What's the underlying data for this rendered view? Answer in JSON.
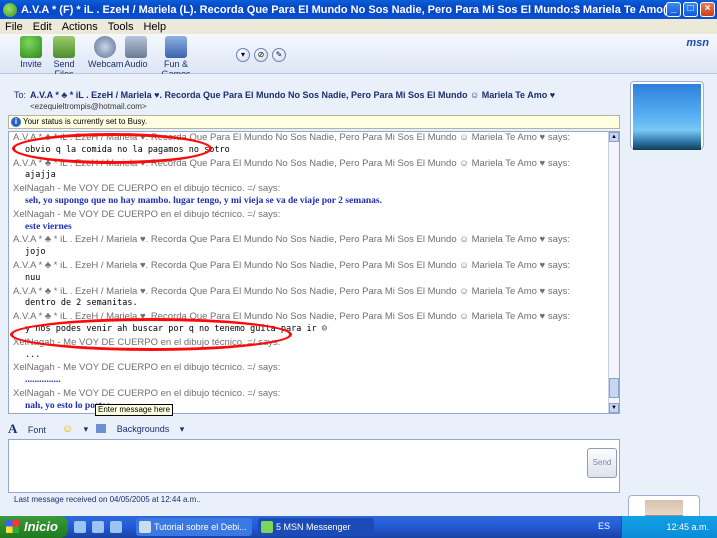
{
  "window": {
    "title": "A.V.A * (F) * iL . EzeH / Mariela (L). Recorda Que Para El Mundo No Sos Nadie, Pero Para Mi Sos El Mundo:$ Mariela Te Amo(L) - Conversation",
    "buttons": [
      "_",
      "□",
      "×"
    ]
  },
  "menu": [
    "File",
    "Edit",
    "Actions",
    "Tools",
    "Help"
  ],
  "toolbar": {
    "items": [
      {
        "label": "Invite",
        "icon": "invite-icon"
      },
      {
        "label": "Send Files",
        "icon": "send-files-icon"
      },
      {
        "label": "Webcam",
        "icon": "webcam-icon"
      },
      {
        "label": "Audio",
        "icon": "audio-icon"
      },
      {
        "label": "Fun & Games",
        "icon": "fun-games-icon"
      }
    ],
    "logo": "msn"
  },
  "to": {
    "label": "To:",
    "name": "A.V.A * ♣ * iL . EzeH / Mariela ♥. Recorda Que Para El Mundo No Sos Nadie, Pero Para Mi Sos El Mundo ☺ Mariela Te Amo ♥",
    "email": "<ezequieltrompis@hotmail.com>"
  },
  "status_notice": "Your status is currently set to Busy.",
  "conversation": [
    {
      "type": "says",
      "text": "A.V.A * ♣ * iL . EzeH / Mariela ♥. Recorda Que Para El Mundo No Sos Nadie, Pero Para Mi Sos El Mundo ☺ Mariela Te Amo ♥ says:"
    },
    {
      "type": "msg",
      "text": "obvio q la comida no la pagamos no sotro"
    },
    {
      "type": "says",
      "text": "A.V.A * ♣ * iL . EzeH / Mariela ♥. Recorda Que Para El Mundo No Sos Nadie, Pero Para Mi Sos El Mundo ☺ Mariela Te Amo ♥ says:"
    },
    {
      "type": "msg",
      "text": "ajajja"
    },
    {
      "type": "says",
      "text": "XelNagah - Me VOY DE CUERPO en el dibujo técnico. =/ says:"
    },
    {
      "type": "blue",
      "text": "seh, yo supongo que no hay mambo. lugar tengo, y mi vieja se va de viaje por 2 semanas."
    },
    {
      "type": "says",
      "text": "XelNagah - Me VOY DE CUERPO en el dibujo técnico. =/ says:"
    },
    {
      "type": "blue",
      "text": "este viernes"
    },
    {
      "type": "says",
      "text": "A.V.A * ♣ * iL . EzeH / Mariela ♥. Recorda Que Para El Mundo No Sos Nadie, Pero Para Mi Sos El Mundo ☺ Mariela Te Amo ♥ says:"
    },
    {
      "type": "msg",
      "text": "jojo"
    },
    {
      "type": "says",
      "text": "A.V.A * ♣ * iL . EzeH / Mariela ♥. Recorda Que Para El Mundo No Sos Nadie, Pero Para Mi Sos El Mundo ☺ Mariela Te Amo ♥ says:"
    },
    {
      "type": "msg",
      "text": "nuu"
    },
    {
      "type": "says",
      "text": "A.V.A * ♣ * iL . EzeH / Mariela ♥. Recorda Que Para El Mundo No Sos Nadie, Pero Para Mi Sos El Mundo ☺ Mariela Te Amo ♥ says:"
    },
    {
      "type": "msg",
      "text": "dentro de 2 semanitas."
    },
    {
      "type": "says",
      "text": "A.V.A * ♣ * iL . EzeH / Mariela ♥. Recorda Que Para El Mundo No Sos Nadie, Pero Para Mi Sos El Mundo ☺ Mariela Te Amo ♥ says:"
    },
    {
      "type": "msg",
      "text": "y nos podes venir ah buscar por q no tenemo guita para ir ☺"
    },
    {
      "type": "says",
      "text": "XelNagah - Me VOY DE CUERPO en el dibujo técnico. =/ says:"
    },
    {
      "type": "msg",
      "text": "..."
    },
    {
      "type": "says",
      "text": "XelNagah - Me VOY DE CUERPO en el dibujo técnico. =/ says:"
    },
    {
      "type": "blue",
      "text": "..............."
    },
    {
      "type": "says",
      "text": "XelNagah - Me VOY DE CUERPO en el dibujo técnico. =/ says:"
    },
    {
      "type": "blue",
      "text": "nah, yo esto lo posteo"
    }
  ],
  "format_bar": {
    "font": "Font",
    "emoticon": "☺",
    "backgrounds": "Backgrounds"
  },
  "input": {
    "tooltip": "Enter message here",
    "send": "Send"
  },
  "last_message": "Last message received on 04/05/2005 at 12:44 a.m..",
  "taskbar": {
    "start": "Inicio",
    "tasks": [
      "Tutorial sobre el Debi...",
      "5 MSN Messenger"
    ],
    "lang": "ES",
    "clock": "12:45 a.m."
  }
}
